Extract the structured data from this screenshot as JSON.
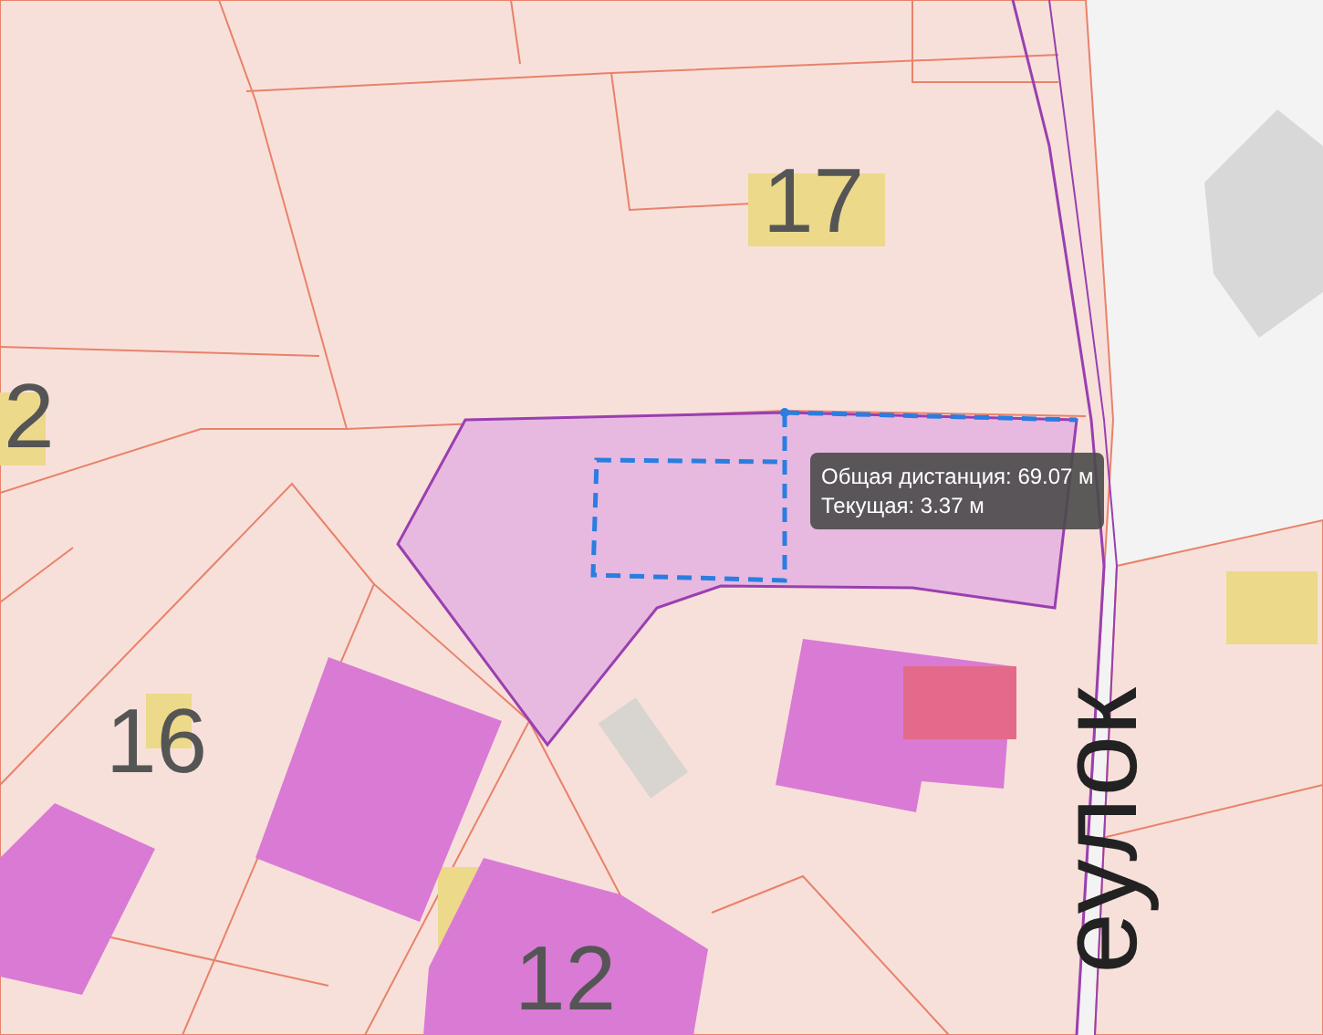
{
  "map": {
    "labels": [
      {
        "text": "17",
        "kind": "number"
      },
      {
        "text": "2",
        "kind": "number"
      },
      {
        "text": "16",
        "kind": "number"
      },
      {
        "text": "12",
        "kind": "number"
      },
      {
        "text": "еулок",
        "kind": "street"
      }
    ]
  },
  "tooltip": {
    "total": "Общая дистанция: 69.07 м",
    "current": "Текущая: 3.37 м"
  }
}
